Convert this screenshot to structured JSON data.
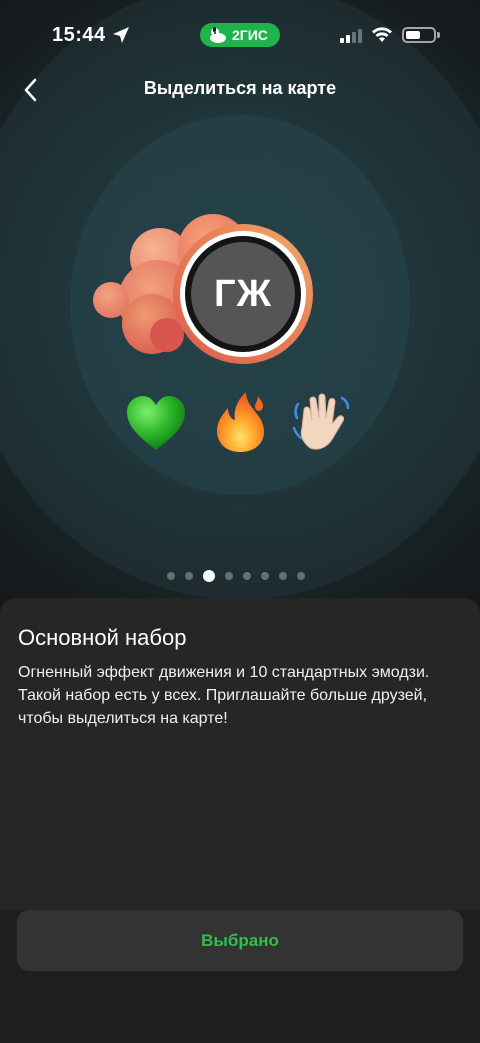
{
  "status_bar": {
    "time": "15:44",
    "app_badge": "2ГИС",
    "app_badge_color": "#1fb34b"
  },
  "header": {
    "title": "Выделиться на карте",
    "back_icon": "chevron-left-icon"
  },
  "preview": {
    "avatar_initials": "ГЖ",
    "emojis": [
      "green-heart-icon",
      "fire-icon",
      "waving-hand-icon"
    ]
  },
  "pager": {
    "total": 8,
    "active_index": 2
  },
  "sheet": {
    "title": "Основной набор",
    "description": "Огненный эффект движения и 10 стандартных эмодзи. Такой набор есть у всех. Приглашайте больше друзей, чтобы выделиться на карте!"
  },
  "action": {
    "label": "Выбрано",
    "color": "#2fbf4f"
  }
}
